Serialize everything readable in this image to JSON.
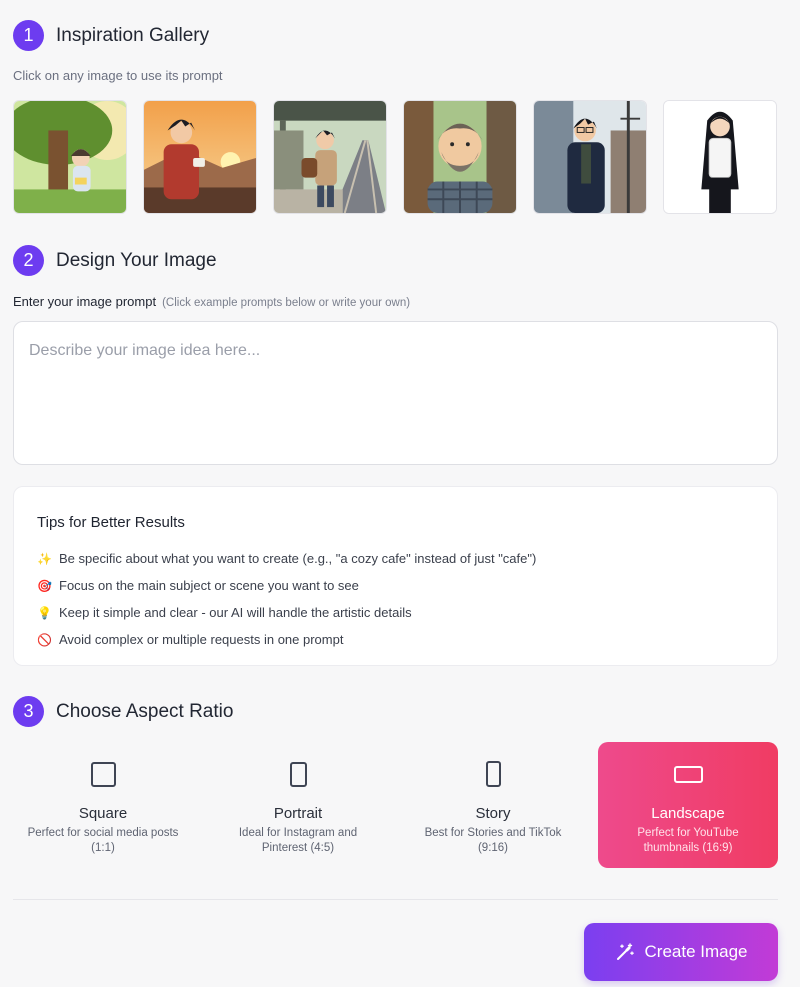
{
  "colors": {
    "accent": "#6d3cf0",
    "active_ratio": "#ee4a8c",
    "button": "#7b3ff0"
  },
  "step1": {
    "number": "1",
    "title": "Inspiration Gallery",
    "subtitle": "Click on any image to use its prompt"
  },
  "gallery": [
    {
      "subject": "girl reading under a tree"
    },
    {
      "subject": "man with coffee at sunset"
    },
    {
      "subject": "boy at train platform"
    },
    {
      "subject": "bearded man smiling"
    },
    {
      "subject": "man with glasses in street"
    },
    {
      "subject": "girl with long black hair"
    }
  ],
  "step2": {
    "number": "2",
    "title": "Design Your Image",
    "prompt_label": "Enter your image prompt",
    "prompt_hint": "(Click example prompts below or write your own)",
    "prompt_value": "",
    "prompt_placeholder": "Describe your image idea here..."
  },
  "tips": {
    "title": "Tips for Better Results",
    "items": [
      {
        "icon": "✨",
        "text": "Be specific about what you want to create (e.g., \"a cozy cafe\" instead of just \"cafe\")"
      },
      {
        "icon": "🎯",
        "text": "Focus on the main subject or scene you want to see"
      },
      {
        "icon": "💡",
        "text": "Keep it simple and clear - our AI will handle the artistic details"
      },
      {
        "icon": "🚫",
        "text": "Avoid complex or multiple requests in one prompt"
      }
    ]
  },
  "step3": {
    "number": "3",
    "title": "Choose Aspect Ratio",
    "selected": "Landscape",
    "options": [
      {
        "name": "Square",
        "desc": "Perfect for social media posts (1:1)"
      },
      {
        "name": "Portrait",
        "desc": "Ideal for Instagram and Pinterest (4:5)"
      },
      {
        "name": "Story",
        "desc": "Best for Stories and TikTok (9:16)"
      },
      {
        "name": "Landscape",
        "desc": "Perfect for YouTube thumbnails (16:9)"
      }
    ]
  },
  "create_button": {
    "label": "Create Image",
    "icon": "magic-wand-icon"
  }
}
